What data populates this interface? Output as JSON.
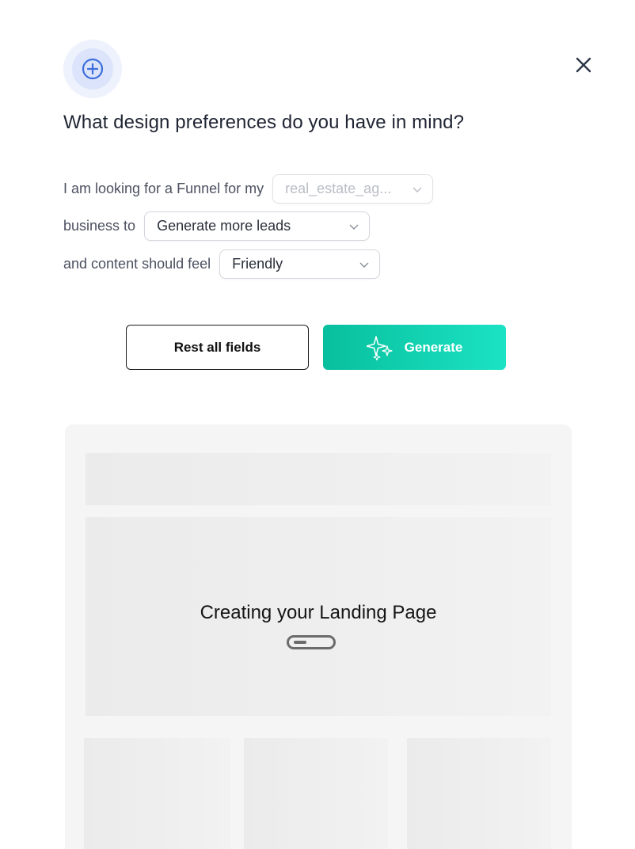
{
  "dialog": {
    "title": "What design preferences do you have in mind?",
    "accent_color": "#3f6fdc"
  },
  "form": {
    "row1": {
      "label": "I am looking for a Funnel for my",
      "select_value": "real_estate_ag...",
      "disabled": true
    },
    "row2": {
      "label": "business to",
      "select_value": "Generate more leads"
    },
    "row3": {
      "label": "and content should feel",
      "select_value": "Friendly"
    }
  },
  "actions": {
    "reset_label": "Rest all fields",
    "generate_label": "Generate",
    "generate_gradient": [
      "#08bf9d",
      "#1be3c4"
    ]
  },
  "preview": {
    "status_text": "Creating your Landing Page"
  },
  "icons": {
    "badge": "plus-circle-icon",
    "close": "close-icon",
    "chevron": "chevron-down-icon",
    "sparkle": "sparkles-icon"
  }
}
